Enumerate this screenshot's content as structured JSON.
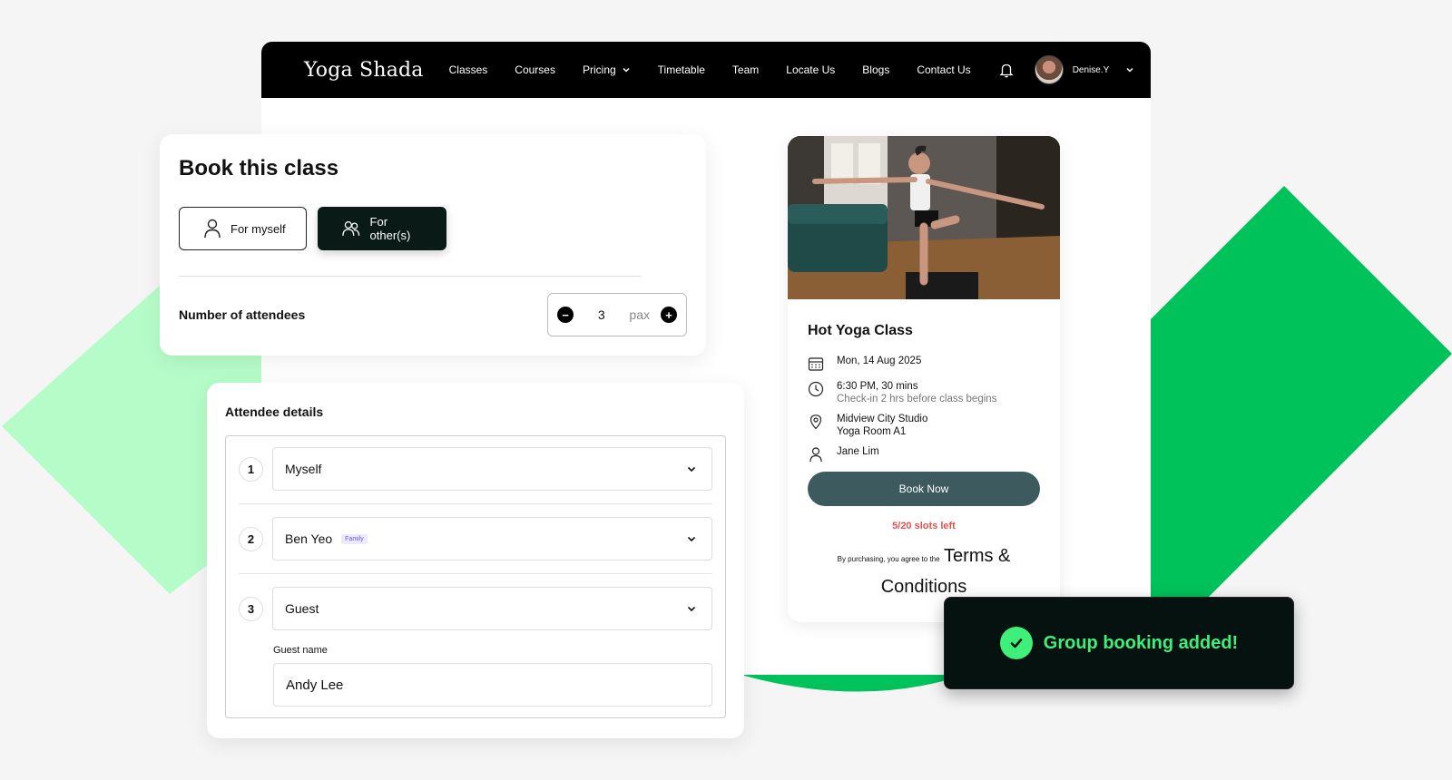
{
  "nav": {
    "logo": "Yoga Shada",
    "links": [
      "Classes",
      "Courses",
      "Pricing",
      "Timetable",
      "Team",
      "Locate Us",
      "Blogs",
      "Contact Us"
    ],
    "user_name": "Denise.Y"
  },
  "book": {
    "title": "Book this class",
    "for_myself": "For myself",
    "for_others": "For other(s)",
    "attendees_label": "Number of attendees",
    "attendees_count": "3",
    "attendees_unit": "pax"
  },
  "details": {
    "title": "Attendee details",
    "items": [
      {
        "num": "1",
        "name": "Myself",
        "tag": ""
      },
      {
        "num": "2",
        "name": "Ben Yeo",
        "tag": "Family"
      },
      {
        "num": "3",
        "name": "Guest",
        "tag": ""
      }
    ],
    "guest_label": "Guest name",
    "guest_value": "Andy Lee"
  },
  "class": {
    "title": "Hot Yoga Class",
    "date": "Mon, 14 Aug 2025",
    "time": "6:30 PM, 30 mins",
    "checkin": "Check-in 2 hrs before class begins",
    "studio": "Midview City Studio",
    "room": "Yoga Room A1",
    "instructor": "Jane Lim",
    "book_label": "Book Now",
    "slots": "5/20 slots left",
    "terms_prefix": "By purchasing, you agree to the",
    "terms_link": "Terms & Conditions"
  },
  "toast": {
    "message": "Group booking added!"
  },
  "colors": {
    "accent_green": "#00c25a",
    "light_green": "#b6fcc9",
    "toast_text": "#3ef07a",
    "book_btn": "#3d5a5e",
    "slots_red": "#e5534b"
  }
}
